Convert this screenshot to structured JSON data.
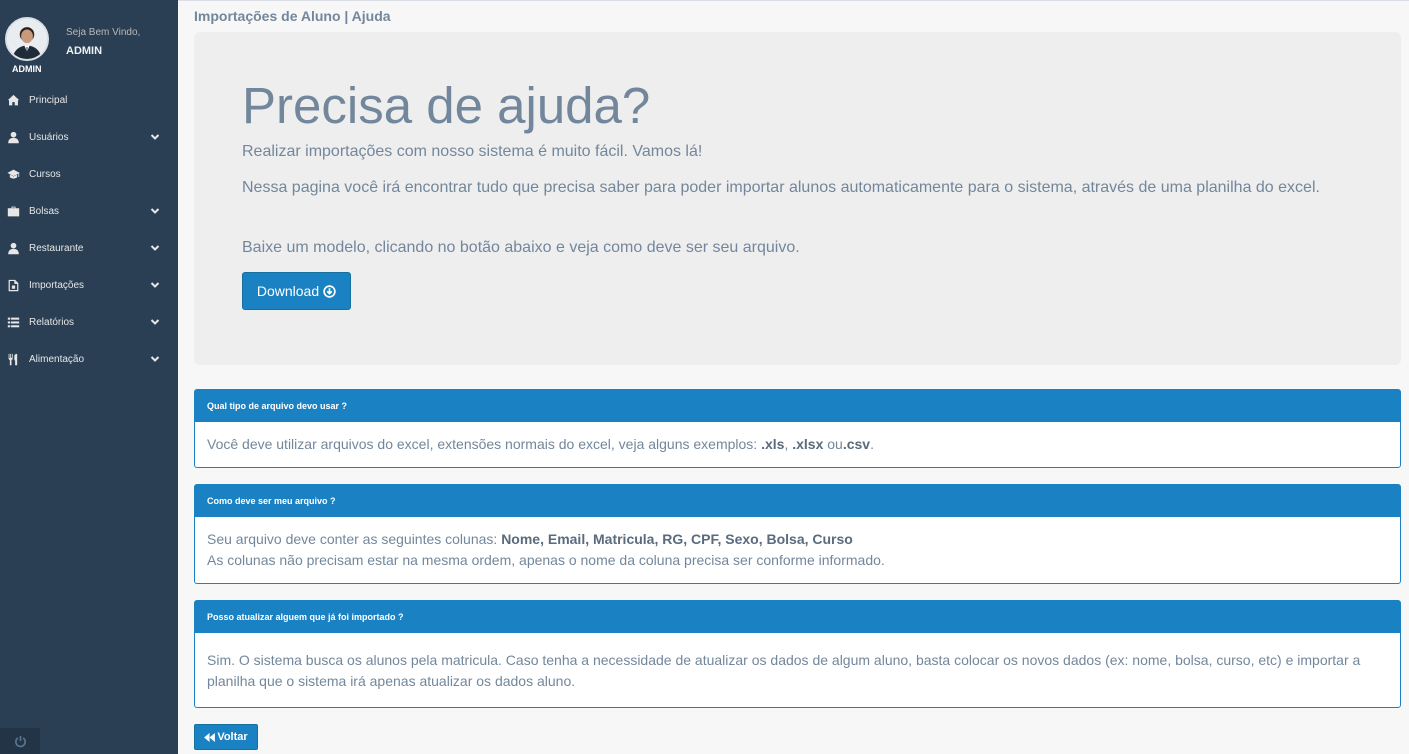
{
  "user": {
    "welcome": "Seja Bem Vindo,",
    "name": "ADMIN",
    "avatar_caption": "ADMIN"
  },
  "sidebar": {
    "items": [
      {
        "label": "Principal",
        "icon": "home-icon",
        "has_submenu": false
      },
      {
        "label": "Usuários",
        "icon": "user-icon",
        "has_submenu": true
      },
      {
        "label": "Cursos",
        "icon": "graduation-cap-icon",
        "has_submenu": false
      },
      {
        "label": "Bolsas",
        "icon": "briefcase-icon",
        "has_submenu": true
      },
      {
        "label": "Restaurante",
        "icon": "user-icon",
        "has_submenu": true
      },
      {
        "label": "Importações",
        "icon": "file-icon",
        "has_submenu": true
      },
      {
        "label": "Relatórios",
        "icon": "list-icon",
        "has_submenu": true
      },
      {
        "label": "Alimentação",
        "icon": "cutlery-icon",
        "has_submenu": true
      }
    ]
  },
  "page": {
    "title": "Importações de Aluno | Ajuda"
  },
  "jumbotron": {
    "title": "Precisa de ajuda?",
    "text1": "Realizar importações com nosso sistema é muito fácil. Vamos lá!",
    "text2": "Nessa pagina você irá encontrar tudo que precisa saber para poder importar alunos automaticamente para o sistema, através de uma planilha do excel.",
    "text3": "Baixe um modelo, clicando no botão abaixo e veja como deve ser seu arquivo.",
    "download_label": "Download"
  },
  "faq": [
    {
      "question": "Qual tipo de arquivo devo usar ?",
      "answer_prefix": "Você deve utilizar arquivos do excel, extensões normais do excel, veja alguns exemplos: ",
      "ext1": ".xls",
      "sep1": ", ",
      "ext2": ".xlsx",
      "sep2": " ou",
      "ext3": ".csv",
      "end": "."
    },
    {
      "question": "Como deve ser meu arquivo ?",
      "answer_prefix": "Seu arquivo deve conter as seguintes colunas: ",
      "columns": "Nome, Email, Matricula, RG, CPF, Sexo, Bolsa, Curso",
      "answer_line2": "As colunas não precisam estar na mesma ordem, apenas o nome da coluna precisa ser conforme informado."
    },
    {
      "question": "Posso atualizar alguem que já foi importado ?",
      "answer": "Sim. O sistema busca os alunos pela matricula. Caso tenha a necessidade de atualizar os dados de algum aluno, basta colocar os novos dados (ex: nome, bolsa, curso, etc) e importar a planilha que o sistema irá apenas atualizar os dados aluno."
    }
  ],
  "back_label": "Voltar",
  "colors": {
    "sidebar_bg": "#2a3f54",
    "accent": "#1a82c3",
    "text": "#73879c"
  }
}
